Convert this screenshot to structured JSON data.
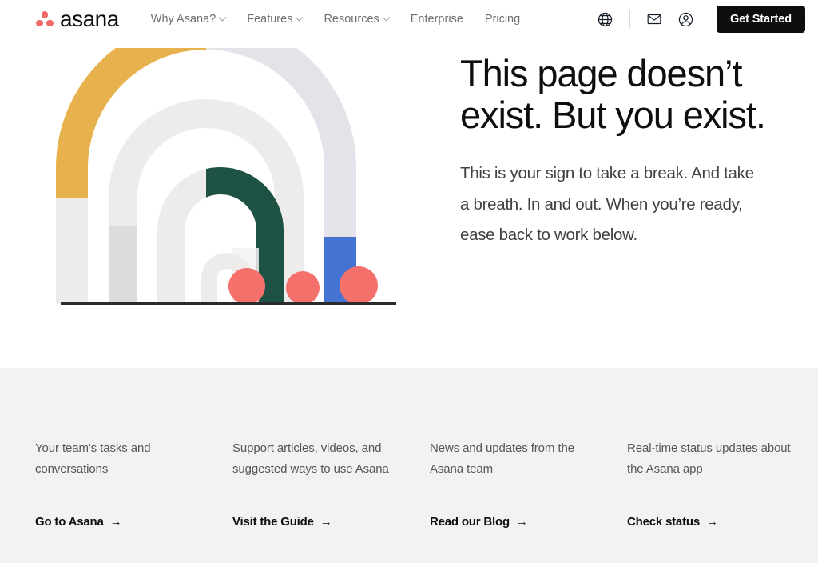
{
  "header": {
    "brand": {
      "name": "asana",
      "logo_icon": "asana-dots-logo",
      "dot_color": "#F06A6A"
    },
    "nav": [
      {
        "label": "Why Asana?",
        "has_dropdown": true
      },
      {
        "label": "Features",
        "has_dropdown": true
      },
      {
        "label": "Resources",
        "has_dropdown": true
      },
      {
        "label": "Enterprise",
        "has_dropdown": false
      },
      {
        "label": "Pricing",
        "has_dropdown": false
      }
    ],
    "actions": {
      "language_icon": "globe-icon",
      "contact_icon": "envelope-icon",
      "account_icon": "user-circle-icon",
      "cta_label": "Get Started",
      "cta_bg": "#0D0E10"
    }
  },
  "hero": {
    "title": "This page doesn’t exist. But you exist.",
    "body": "This is your sign to take a break. And take a breath. In and out. When you’re ready, ease back to work below.",
    "illustration": {
      "name": "arches-404-illustration",
      "colors": {
        "yellow": "#E7B14D",
        "lavender": "#E4E3E9",
        "blue": "#4573D2",
        "green": "#1E5245",
        "gray_light": "#EDECEA",
        "gray_mid": "#DEDCDA",
        "coral": "#F4706B",
        "baseline": "#2B2B2B"
      }
    }
  },
  "panel": {
    "columns": [
      {
        "desc": "Your team's tasks and conversations",
        "link": "Go to Asana",
        "arrow": "→"
      },
      {
        "desc": "Support articles, videos, and suggested ways to use Asana",
        "link": "Visit the Guide",
        "arrow": "→"
      },
      {
        "desc": "News and updates from the Asana team",
        "link": "Read our Blog",
        "arrow": "→"
      },
      {
        "desc": "Real-time status updates about the Asana app",
        "link": "Check status",
        "arrow": "→"
      }
    ],
    "bg": "#F3F1F1"
  }
}
